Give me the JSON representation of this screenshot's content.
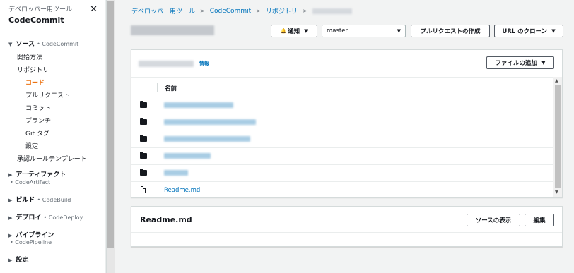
{
  "sidebar": {
    "service_label": "デベロッパー用ツール",
    "product_title": "CodeCommit",
    "close_label": "✕",
    "source_section": {
      "label": "ソース",
      "sub": "• CodeCommit"
    },
    "items": [
      {
        "label": "開始方法"
      },
      {
        "label": "リポジトリ"
      },
      {
        "label": "コード",
        "active": true
      },
      {
        "label": "プルリクエスト"
      },
      {
        "label": "コミット"
      },
      {
        "label": "ブランチ"
      },
      {
        "label": "Git タグ"
      },
      {
        "label": "設定"
      },
      {
        "label": "承認ルールテンプレート"
      }
    ],
    "sections": [
      {
        "label": "アーティファクト",
        "sub": "• CodeArtifact"
      },
      {
        "label": "ビルド",
        "sub": "• CodeBuild"
      },
      {
        "label": "デプロイ",
        "sub": "• CodeDeploy"
      },
      {
        "label": "パイプライン",
        "sub": "• CodePipeline"
      },
      {
        "label": "設定",
        "sub": ""
      }
    ],
    "triangle_down": "▼",
    "triangle_right": "▶"
  },
  "breadcrumb": {
    "items": [
      "デベロッパー用ツール",
      "CodeCommit",
      "リポジトリ"
    ],
    "separator": ">"
  },
  "toolbar": {
    "notify_label": "通知",
    "bell_icon": "🔔",
    "branch_value": "master",
    "create_pr_label": "プルリクエストの作成",
    "clone_url_label": "URL のクローン",
    "caret": "▼"
  },
  "files": {
    "info_label": "情報",
    "add_file_label": "ファイルの追加",
    "column_name": "名前",
    "readme_file": "Readme.md"
  },
  "readme": {
    "title": "Readme.md",
    "view_source_label": "ソースの表示",
    "edit_label": "編集"
  },
  "scroll": {
    "up": "▲",
    "down": "▼"
  }
}
